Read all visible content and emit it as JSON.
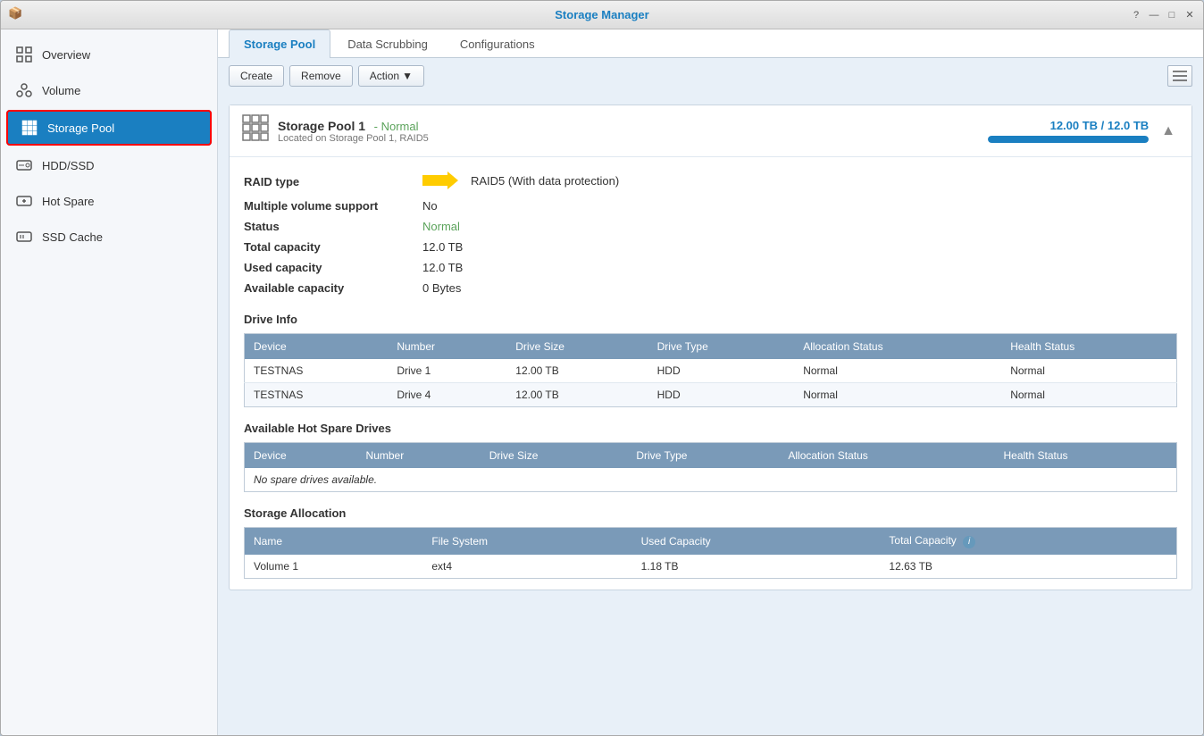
{
  "window": {
    "title": "Storage Manager",
    "icon": "📦"
  },
  "titlebar_controls": [
    "?",
    "—",
    "□",
    "✕"
  ],
  "sidebar": {
    "items": [
      {
        "id": "overview",
        "label": "Overview",
        "icon": "📊",
        "active": false
      },
      {
        "id": "volume",
        "label": "Volume",
        "icon": "👥",
        "active": false
      },
      {
        "id": "storage-pool",
        "label": "Storage Pool",
        "icon": "▦",
        "active": true
      },
      {
        "id": "hdd-ssd",
        "label": "HDD/SSD",
        "icon": "💿",
        "active": false
      },
      {
        "id": "hot-spare",
        "label": "Hot Spare",
        "icon": "➕",
        "active": false
      },
      {
        "id": "ssd-cache",
        "label": "SSD Cache",
        "icon": "⚡",
        "active": false
      }
    ]
  },
  "tabs": [
    {
      "id": "storage-pool",
      "label": "Storage Pool",
      "active": true
    },
    {
      "id": "data-scrubbing",
      "label": "Data Scrubbing",
      "active": false
    },
    {
      "id": "configurations",
      "label": "Configurations",
      "active": false
    }
  ],
  "toolbar": {
    "create_label": "Create",
    "remove_label": "Remove",
    "action_label": "Action",
    "action_arrow": "▼"
  },
  "pool": {
    "title": "Storage Pool 1",
    "status_label": "- Normal",
    "subtitle": "Located on Storage Pool 1, RAID5",
    "capacity_text": "12.00 TB / 12.0 TB",
    "capacity_percent": 100,
    "details": [
      {
        "label": "RAID type",
        "value": "RAID5  (With data protection)",
        "type": "normal_text",
        "has_arrow": true
      },
      {
        "label": "Multiple volume support",
        "value": "No",
        "type": "normal_text"
      },
      {
        "label": "Status",
        "value": "Normal",
        "type": "green"
      },
      {
        "label": "Total capacity",
        "value": "12.0  TB",
        "type": "normal_text"
      },
      {
        "label": "Used capacity",
        "value": "12.0  TB",
        "type": "normal_text"
      },
      {
        "label": "Available capacity",
        "value": "0 Bytes",
        "type": "normal_text"
      }
    ],
    "drive_info": {
      "section_title": "Drive Info",
      "columns": [
        "Device",
        "Number",
        "Drive Size",
        "Drive Type",
        "Allocation Status",
        "Health Status"
      ],
      "rows": [
        {
          "device": "TESTNAS",
          "number": "Drive 1",
          "size": "12.00 TB",
          "type": "HDD",
          "allocation": "Normal",
          "health": "Normal"
        },
        {
          "device": "TESTNAS",
          "number": "Drive 4",
          "size": "12.00 TB",
          "type": "HDD",
          "allocation": "Normal",
          "health": "Normal"
        }
      ]
    },
    "hot_spare": {
      "section_title": "Available Hot Spare Drives",
      "columns": [
        "Device",
        "Number",
        "Drive Size",
        "Drive Type",
        "Allocation Status",
        "Health Status"
      ],
      "no_data_msg": "No spare drives available."
    },
    "storage_allocation": {
      "section_title": "Storage Allocation",
      "columns": [
        "Name",
        "File System",
        "Used Capacity",
        "Total Capacity ℹ"
      ],
      "rows": [
        {
          "name": "Volume 1",
          "fs": "ext4",
          "used": "1.18 TB",
          "total": "12.63 TB"
        }
      ]
    }
  }
}
